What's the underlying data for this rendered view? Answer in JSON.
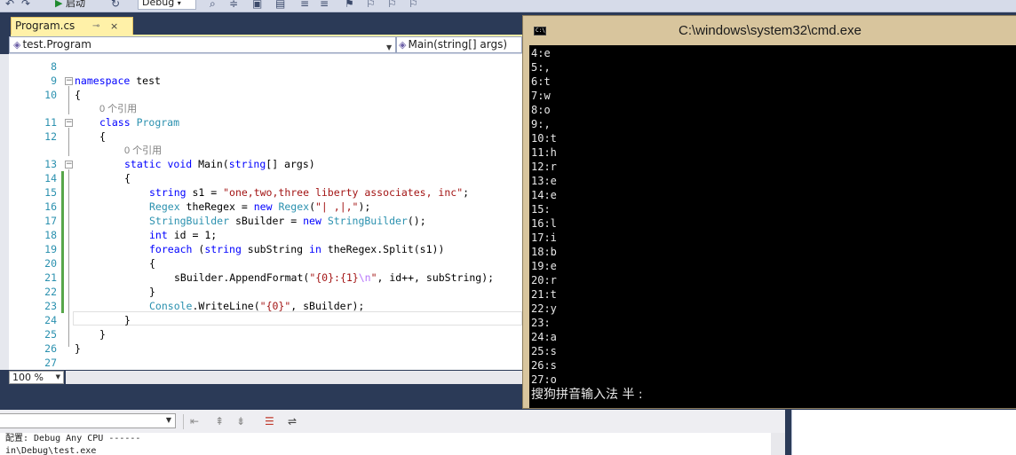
{
  "toolbar": {
    "start_label": "启动",
    "config_value": "Debug"
  },
  "editor": {
    "tab_title": "Program.cs",
    "tab_pin": "⊸",
    "tab_close": "×",
    "nav_type": "test.Program",
    "nav_member": "Main(string[] args)",
    "zoom": "100 %",
    "codelens_refs": "0 个引用",
    "line_numbers": [
      "8",
      "9",
      "10",
      "11",
      "12",
      "13",
      "14",
      "15",
      "16",
      "17",
      "18",
      "19",
      "20",
      "21",
      "22",
      "23",
      "24",
      "25",
      "26",
      "27"
    ],
    "code": {
      "l9_kw": "namespace",
      "l9_name": " test",
      "l10": "{",
      "l11_kw": "class",
      "l11_name": "Program",
      "l12": "{",
      "l13_kw1": "static",
      "l13_kw2": "void",
      "l13_name": " Main(",
      "l13_kw3": "string",
      "l13_rest": "[] args)",
      "l14": "{",
      "l15_kw": "string",
      "l15_mid": " s1 = ",
      "l15_str": "\"one,two,three liberty associates, inc\"",
      "l15_end": ";",
      "l16_ty": "Regex",
      "l16_mid": " theRegex = ",
      "l16_kw": "new",
      "l16_ty2": "Regex",
      "l16_open": "(",
      "l16_str": "\"| ,|,\"",
      "l16_end": ");",
      "l17_ty": "StringBuilder",
      "l17_mid": " sBuilder = ",
      "l17_kw": "new",
      "l17_ty2": "StringBuilder",
      "l17_end": "();",
      "l18_kw": "int",
      "l18_rest": " id = 1;",
      "l19_kw": "foreach",
      "l19_open": " (",
      "l19_kw2": "string",
      "l19_mid": " subString ",
      "l19_kw3": "in",
      "l19_rest": " theRegex.Split(s1))",
      "l20": "{",
      "l21_pre": "sBuilder.AppendFormat(",
      "l21_str1": "\"{0}:{1}",
      "l21_esc": "\\n",
      "l21_str2": "\"",
      "l21_rest": ", id++, subString);",
      "l22": "}",
      "l23_ty": "Console",
      "l23_mid": ".WriteLine(",
      "l23_str": "\"{0}\"",
      "l23_rest": ", sBuilder);",
      "l24": "}",
      "l25": "}",
      "l26": "}"
    }
  },
  "cmd": {
    "title": "C:\\windows\\system32\\cmd.exe",
    "icon_label": "C:\\",
    "lines": [
      "4:e",
      "5:,",
      "6:t",
      "7:w",
      "8:o",
      "9:,",
      "10:t",
      "11:h",
      "12:r",
      "13:e",
      "14:e",
      "15:",
      "16:l",
      "17:i",
      "18:b",
      "19:e",
      "20:r",
      "21:t",
      "22:y",
      "23:",
      "24:a",
      "25:s",
      "26:s",
      "27:o"
    ],
    "ime_status": "搜狗拼音输入法 半 :"
  },
  "output": {
    "line1": "配置: Debug Any CPU ------",
    "line2": "in\\Debug\\test.exe"
  }
}
